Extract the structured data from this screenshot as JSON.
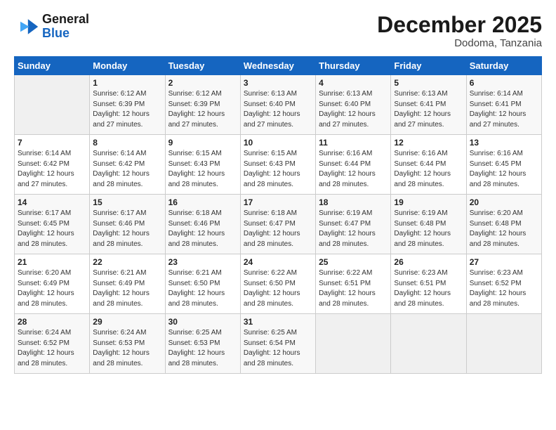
{
  "header": {
    "logo_general": "General",
    "logo_blue": "Blue",
    "month_title": "December 2025",
    "location": "Dodoma, Tanzania"
  },
  "days_of_week": [
    "Sunday",
    "Monday",
    "Tuesday",
    "Wednesday",
    "Thursday",
    "Friday",
    "Saturday"
  ],
  "weeks": [
    [
      {
        "day": "",
        "detail": ""
      },
      {
        "day": "1",
        "detail": "Sunrise: 6:12 AM\nSunset: 6:39 PM\nDaylight: 12 hours\nand 27 minutes."
      },
      {
        "day": "2",
        "detail": "Sunrise: 6:12 AM\nSunset: 6:39 PM\nDaylight: 12 hours\nand 27 minutes."
      },
      {
        "day": "3",
        "detail": "Sunrise: 6:13 AM\nSunset: 6:40 PM\nDaylight: 12 hours\nand 27 minutes."
      },
      {
        "day": "4",
        "detail": "Sunrise: 6:13 AM\nSunset: 6:40 PM\nDaylight: 12 hours\nand 27 minutes."
      },
      {
        "day": "5",
        "detail": "Sunrise: 6:13 AM\nSunset: 6:41 PM\nDaylight: 12 hours\nand 27 minutes."
      },
      {
        "day": "6",
        "detail": "Sunrise: 6:14 AM\nSunset: 6:41 PM\nDaylight: 12 hours\nand 27 minutes."
      }
    ],
    [
      {
        "day": "7",
        "detail": "Sunrise: 6:14 AM\nSunset: 6:42 PM\nDaylight: 12 hours\nand 27 minutes."
      },
      {
        "day": "8",
        "detail": "Sunrise: 6:14 AM\nSunset: 6:42 PM\nDaylight: 12 hours\nand 28 minutes."
      },
      {
        "day": "9",
        "detail": "Sunrise: 6:15 AM\nSunset: 6:43 PM\nDaylight: 12 hours\nand 28 minutes."
      },
      {
        "day": "10",
        "detail": "Sunrise: 6:15 AM\nSunset: 6:43 PM\nDaylight: 12 hours\nand 28 minutes."
      },
      {
        "day": "11",
        "detail": "Sunrise: 6:16 AM\nSunset: 6:44 PM\nDaylight: 12 hours\nand 28 minutes."
      },
      {
        "day": "12",
        "detail": "Sunrise: 6:16 AM\nSunset: 6:44 PM\nDaylight: 12 hours\nand 28 minutes."
      },
      {
        "day": "13",
        "detail": "Sunrise: 6:16 AM\nSunset: 6:45 PM\nDaylight: 12 hours\nand 28 minutes."
      }
    ],
    [
      {
        "day": "14",
        "detail": "Sunrise: 6:17 AM\nSunset: 6:45 PM\nDaylight: 12 hours\nand 28 minutes."
      },
      {
        "day": "15",
        "detail": "Sunrise: 6:17 AM\nSunset: 6:46 PM\nDaylight: 12 hours\nand 28 minutes."
      },
      {
        "day": "16",
        "detail": "Sunrise: 6:18 AM\nSunset: 6:46 PM\nDaylight: 12 hours\nand 28 minutes."
      },
      {
        "day": "17",
        "detail": "Sunrise: 6:18 AM\nSunset: 6:47 PM\nDaylight: 12 hours\nand 28 minutes."
      },
      {
        "day": "18",
        "detail": "Sunrise: 6:19 AM\nSunset: 6:47 PM\nDaylight: 12 hours\nand 28 minutes."
      },
      {
        "day": "19",
        "detail": "Sunrise: 6:19 AM\nSunset: 6:48 PM\nDaylight: 12 hours\nand 28 minutes."
      },
      {
        "day": "20",
        "detail": "Sunrise: 6:20 AM\nSunset: 6:48 PM\nDaylight: 12 hours\nand 28 minutes."
      }
    ],
    [
      {
        "day": "21",
        "detail": "Sunrise: 6:20 AM\nSunset: 6:49 PM\nDaylight: 12 hours\nand 28 minutes."
      },
      {
        "day": "22",
        "detail": "Sunrise: 6:21 AM\nSunset: 6:49 PM\nDaylight: 12 hours\nand 28 minutes."
      },
      {
        "day": "23",
        "detail": "Sunrise: 6:21 AM\nSunset: 6:50 PM\nDaylight: 12 hours\nand 28 minutes."
      },
      {
        "day": "24",
        "detail": "Sunrise: 6:22 AM\nSunset: 6:50 PM\nDaylight: 12 hours\nand 28 minutes."
      },
      {
        "day": "25",
        "detail": "Sunrise: 6:22 AM\nSunset: 6:51 PM\nDaylight: 12 hours\nand 28 minutes."
      },
      {
        "day": "26",
        "detail": "Sunrise: 6:23 AM\nSunset: 6:51 PM\nDaylight: 12 hours\nand 28 minutes."
      },
      {
        "day": "27",
        "detail": "Sunrise: 6:23 AM\nSunset: 6:52 PM\nDaylight: 12 hours\nand 28 minutes."
      }
    ],
    [
      {
        "day": "28",
        "detail": "Sunrise: 6:24 AM\nSunset: 6:52 PM\nDaylight: 12 hours\nand 28 minutes."
      },
      {
        "day": "29",
        "detail": "Sunrise: 6:24 AM\nSunset: 6:53 PM\nDaylight: 12 hours\nand 28 minutes."
      },
      {
        "day": "30",
        "detail": "Sunrise: 6:25 AM\nSunset: 6:53 PM\nDaylight: 12 hours\nand 28 minutes."
      },
      {
        "day": "31",
        "detail": "Sunrise: 6:25 AM\nSunset: 6:54 PM\nDaylight: 12 hours\nand 28 minutes."
      },
      {
        "day": "",
        "detail": ""
      },
      {
        "day": "",
        "detail": ""
      },
      {
        "day": "",
        "detail": ""
      }
    ]
  ]
}
